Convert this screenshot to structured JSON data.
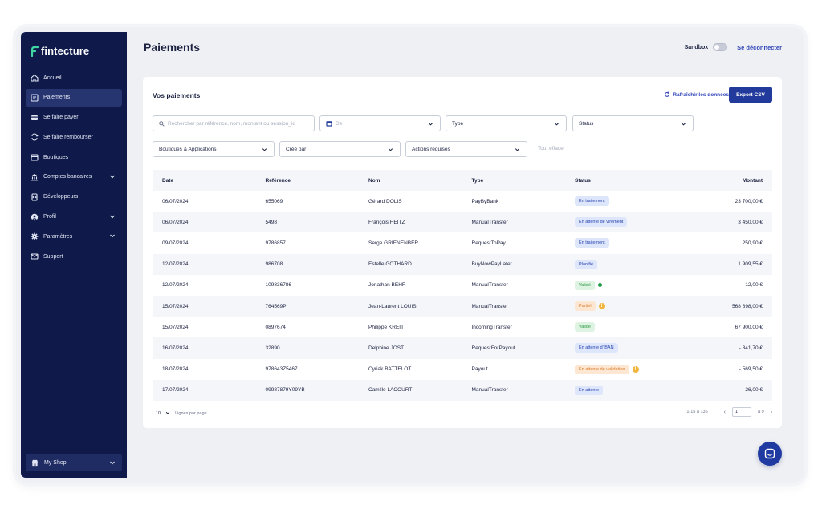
{
  "brand": {
    "name": "fintecture"
  },
  "sidebar": {
    "items": [
      {
        "label": "Accueil",
        "icon": "home-icon",
        "active": false,
        "expandable": false
      },
      {
        "label": "Paiements",
        "icon": "payments-icon",
        "active": true,
        "expandable": false
      },
      {
        "label": "Se faire payer",
        "icon": "card-icon",
        "active": false,
        "expandable": false
      },
      {
        "label": "Se faire rembourser",
        "icon": "refund-icon",
        "active": false,
        "expandable": false
      },
      {
        "label": "Boutiques",
        "icon": "store-icon",
        "active": false,
        "expandable": false
      },
      {
        "label": "Comptes bancaires",
        "icon": "bank-icon",
        "active": false,
        "expandable": true
      },
      {
        "label": "Développeurs",
        "icon": "developer-icon",
        "active": false,
        "expandable": false
      },
      {
        "label": "Profil",
        "icon": "user-icon",
        "active": false,
        "expandable": true
      },
      {
        "label": "Paramètres",
        "icon": "gear-icon",
        "active": false,
        "expandable": true
      },
      {
        "label": "Support",
        "icon": "mail-icon",
        "active": false,
        "expandable": false
      }
    ],
    "shop": {
      "label": "My Shop",
      "icon": "shop-icon"
    }
  },
  "header": {
    "title": "Paiements",
    "sandbox_label": "Sandbox",
    "logout_label": "Se déconnecter"
  },
  "card": {
    "title": "Vos paiements",
    "refresh_label": "Rafraîchir les données",
    "export_label": "Export CSV"
  },
  "filters": {
    "search_placeholder": "Rechercher par référence, nom, montant ou session_id",
    "date_placeholder": "De",
    "type_label": "Type",
    "status_label": "Status",
    "boutiques_label": "Boutiques & Applications",
    "cree_par_label": "Créé par",
    "actions_label": "Actions requises",
    "clear_label": "Tout effacer"
  },
  "table": {
    "headers": {
      "date": "Date",
      "ref": "Référence",
      "nom": "Nom",
      "type": "Type",
      "status": "Status",
      "amount": "Montant"
    },
    "rows": [
      {
        "date": "06/07/2024",
        "ref": "655069",
        "nom": "Gérard DOLIS",
        "type": "PayByBank",
        "status": "En traitement",
        "status_color": "blue",
        "indicator": "",
        "amount": "23 700,00 €"
      },
      {
        "date": "06/07/2024",
        "ref": "5498",
        "nom": "François HEITZ",
        "type": "ManualTransfer",
        "status": "En attente de virement",
        "status_color": "blue",
        "indicator": "",
        "amount": "3 450,00 €"
      },
      {
        "date": "09/07/2024",
        "ref": "9786857",
        "nom": "Serge GRIENENBER...",
        "type": "RequestToPay",
        "status": "En traitement",
        "status_color": "blue",
        "indicator": "",
        "amount": "250,90 €"
      },
      {
        "date": "12/07/2024",
        "ref": "986708",
        "nom": "Estelle GOTHARD",
        "type": "BuyNowPayLater",
        "status": "Planifié",
        "status_color": "blue",
        "indicator": "",
        "amount": "1 909,55 €"
      },
      {
        "date": "12/07/2024",
        "ref": "109836786",
        "nom": "Jonathan BEHR",
        "type": "ManualTransfer",
        "status": "Validé",
        "status_color": "green",
        "indicator": "green-dot",
        "amount": "12,00 €"
      },
      {
        "date": "15/07/2024",
        "ref": "764569P",
        "nom": "Jean-Laurent LOUIS",
        "type": "ManualTransfer",
        "status": "Partiel",
        "status_color": "orange",
        "indicator": "warning",
        "amount": "568 898,00 €"
      },
      {
        "date": "15/07/2024",
        "ref": "0897674",
        "nom": "Philippe KREIT",
        "type": "IncomingTransfer",
        "status": "Validé",
        "status_color": "green",
        "indicator": "",
        "amount": "67 900,00 €"
      },
      {
        "date": "16/07/2024",
        "ref": "32890",
        "nom": "Delphine JOST",
        "type": "RequestForPayout",
        "status": "En attente d'IBAN",
        "status_color": "blue",
        "indicator": "",
        "amount": "- 341,70 €"
      },
      {
        "date": "18/07/2024",
        "ref": "978643Z5467",
        "nom": "Cyriak BATTELOT",
        "type": "Payout",
        "status": "En attente de validation",
        "status_color": "orange",
        "indicator": "warning",
        "amount": "- 569,50 €"
      },
      {
        "date": "17/07/2024",
        "ref": "09987879Y09YB",
        "nom": "Camille LACOURT",
        "type": "ManualTransfer",
        "status": "En attente",
        "status_color": "blue",
        "indicator": "",
        "amount": "26,00 €"
      }
    ]
  },
  "pagination": {
    "per_page": "10",
    "per_page_label": "Lignes par page",
    "range": "1-15 à 135",
    "current_page": "1",
    "total_pages": "à 9",
    "prev": "‹",
    "next": "›"
  },
  "colors": {
    "sidebar": "#0f1a4a",
    "accent": "#213a9c",
    "link": "#2f44b8"
  }
}
